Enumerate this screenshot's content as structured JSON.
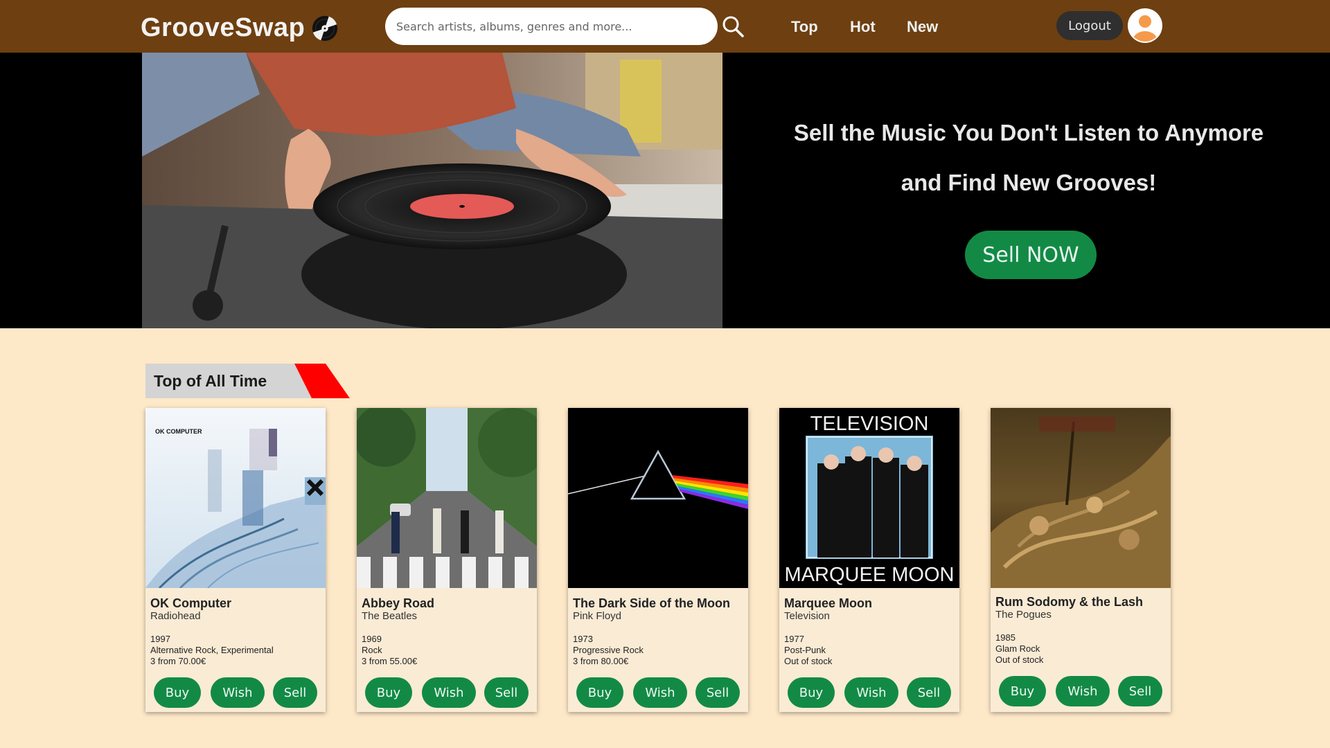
{
  "header": {
    "logo": "GrooveSwap",
    "search_placeholder": "Search artists, albums, genres and more...",
    "nav": [
      {
        "label": "Top"
      },
      {
        "label": "Hot"
      },
      {
        "label": "New"
      }
    ],
    "logout_label": "Logout"
  },
  "hero": {
    "line1": "Sell the Music You Don't Listen to Anymore",
    "line2": "and Find New Grooves!",
    "button_label": "Sell NOW"
  },
  "section": {
    "title": "Top of All Time"
  },
  "albums": [
    {
      "title": "OK Computer",
      "artist": "Radiohead",
      "year": "1997",
      "genre": "Alternative Rock, Experimental",
      "price": "3 from 70.00€",
      "cover_text": "OK COMPUTER"
    },
    {
      "title": "Abbey Road",
      "artist": "The Beatles",
      "year": "1969",
      "genre": "Rock",
      "price": "3 from 55.00€"
    },
    {
      "title": "The Dark Side of the Moon",
      "artist": "Pink Floyd",
      "year": "1973",
      "genre": "Progressive Rock",
      "price": "3 from 80.00€"
    },
    {
      "title": "Marquee Moon",
      "artist": "Television",
      "year": "1977",
      "genre": "Post-Punk",
      "price": "Out of stock",
      "cover_top": "TELEVISION",
      "cover_bottom": "MARQUEE MOON"
    },
    {
      "title": "Rum Sodomy & the Lash",
      "artist": "The Pogues",
      "year": "1985",
      "genre": "Glam Rock",
      "price": "Out of stock"
    }
  ],
  "buttons": {
    "buy": "Buy",
    "wish": "Wish",
    "sell": "Sell"
  },
  "colors": {
    "header": "#6e3f10",
    "accent": "#128a46",
    "page": "#fde8c8",
    "ribbon": "#ff0000"
  }
}
